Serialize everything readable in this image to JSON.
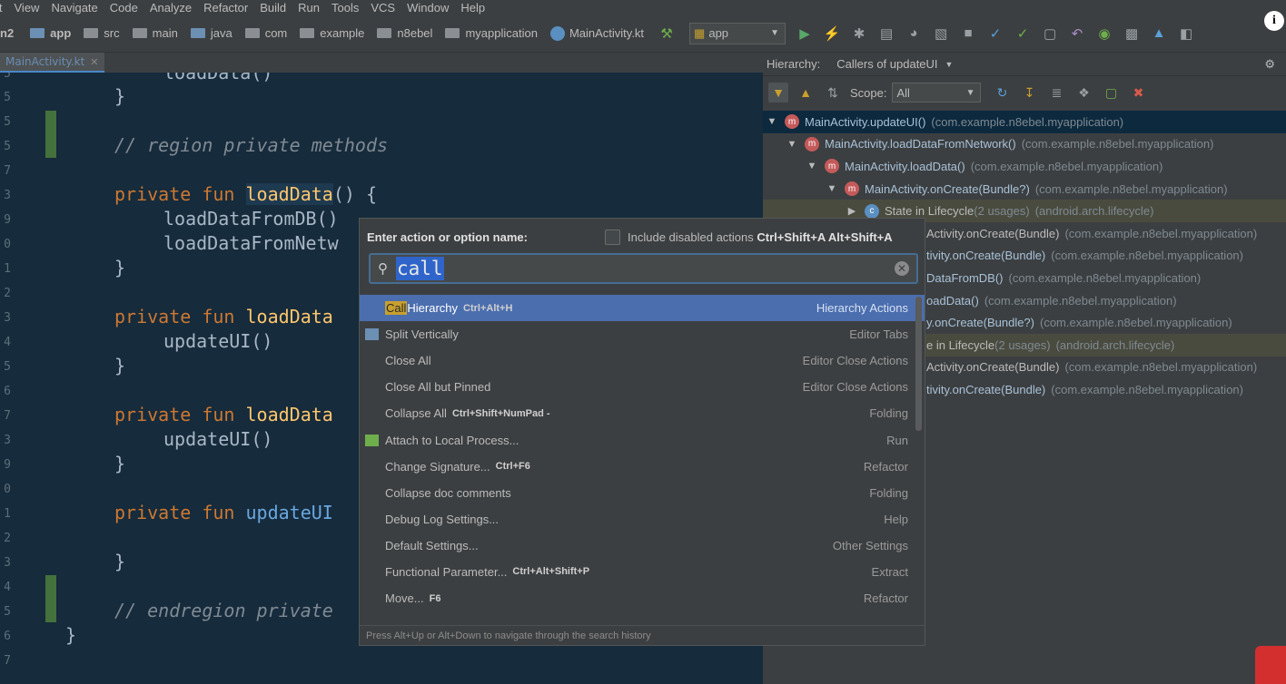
{
  "menu": [
    "it",
    "View",
    "Navigate",
    "Code",
    "Analyze",
    "Refactor",
    "Build",
    "Run",
    "Tools",
    "VCS",
    "Window",
    "Help"
  ],
  "nav": {
    "left_label": "n2",
    "crumbs": [
      "app",
      "src",
      "main",
      "java",
      "com",
      "example",
      "n8ebel",
      "myapplication",
      "MainActivity.kt"
    ],
    "run_config": "app"
  },
  "editor": {
    "tab": "MainActivity.kt",
    "gutter": [
      "5",
      "5",
      "5",
      "5",
      "7",
      "3",
      "9",
      "0",
      "1",
      "2",
      "3",
      "4",
      "5",
      "6",
      "7",
      "3",
      "9",
      "0",
      "1",
      "2",
      "3",
      "4",
      "5",
      "6",
      "7"
    ],
    "lines": {
      "l0": "loadData()",
      "l1": "}",
      "l2": "// region private methods",
      "l3_kw": "private fun",
      "l3_fn": "loadData",
      "l3_tail": "() {",
      "l4": "loadDataFromDB()",
      "l5": "loadDataFromNetw",
      "l6": "}",
      "l7_kw": "private fun",
      "l7_fn": "loadData",
      "l8": "updateUI()",
      "l9": "}",
      "l10_kw": "private fun",
      "l10_fn": "loadData",
      "l11": "updateUI()",
      "l12": "}",
      "l13_kw": "private fun",
      "l13_fn": "updateUI",
      "l14": "}",
      "l15": "// endregion private",
      "l16": "}"
    }
  },
  "hierarchy": {
    "label": "Hierarchy:",
    "type": "Callers of updateUI",
    "scope_label": "Scope:",
    "scope_value": "All",
    "rows": [
      {
        "name": "MainActivity.updateUI()",
        "pkg": "(com.example.n8ebel.myapplication)"
      },
      {
        "name": "MainActivity.loadDataFromNetwork()",
        "pkg": "(com.example.n8ebel.myapplication)"
      },
      {
        "name": "MainActivity.loadData()",
        "pkg": "(com.example.n8ebel.myapplication)"
      },
      {
        "name": "MainActivity.onCreate(Bundle?)",
        "pkg": "(com.example.n8ebel.myapplication)"
      },
      {
        "name": "State in Lifecycle",
        "count": "(2 usages)",
        "pkg": "(android.arch.lifecycle)"
      },
      {
        "name": "Activity.onCreate(Bundle)",
        "pkg": "(com.example.n8ebel.myapplication)"
      },
      {
        "name": "tivity.onCreate(Bundle)",
        "pkg": "(com.example.n8ebel.myapplication)"
      },
      {
        "name": "DataFromDB()",
        "pkg": "(com.example.n8ebel.myapplication)"
      },
      {
        "name": "oadData()",
        "pkg": "(com.example.n8ebel.myapplication)"
      },
      {
        "name": "y.onCreate(Bundle?)",
        "pkg": "(com.example.n8ebel.myapplication)"
      },
      {
        "name": "e in Lifecycle",
        "count": "(2 usages)",
        "pkg": "(android.arch.lifecycle)"
      },
      {
        "name": "Activity.onCreate(Bundle)",
        "pkg": "(com.example.n8ebel.myapplication)"
      },
      {
        "name": "tivity.onCreate(Bundle)",
        "pkg": "(com.example.n8ebel.myapplication)"
      }
    ]
  },
  "popup": {
    "title": "Enter action or option name:",
    "include_label": "Include disabled actions",
    "include_shortcut": "Ctrl+Shift+A Alt+Shift+A",
    "query": "call",
    "results": [
      {
        "label_hl": "Call",
        "label": " Hierarchy",
        "shortcut": "Ctrl+Alt+H",
        "group": "Hierarchy Actions"
      },
      {
        "label": "Split Vertically",
        "shortcut": "",
        "group": "Editor Tabs"
      },
      {
        "label": "Close All",
        "shortcut": "",
        "group": "Editor Close Actions"
      },
      {
        "label": "Close All but Pinned",
        "shortcut": "",
        "group": "Editor Close Actions"
      },
      {
        "label": "Collapse All",
        "shortcut": "Ctrl+Shift+NumPad -",
        "group": "Folding"
      },
      {
        "label": "Attach to Local Process...",
        "shortcut": "",
        "group": "Run"
      },
      {
        "label": "Change Signature...",
        "shortcut": "Ctrl+F6",
        "group": "Refactor"
      },
      {
        "label": "Collapse doc comments",
        "shortcut": "",
        "group": "Folding"
      },
      {
        "label": "Debug Log Settings...",
        "shortcut": "",
        "group": "Help"
      },
      {
        "label": "Default Settings...",
        "shortcut": "",
        "group": "Other Settings"
      },
      {
        "label": "Functional Parameter...",
        "shortcut": "Ctrl+Alt+Shift+P",
        "group": "Extract"
      },
      {
        "label": "Move...",
        "shortcut": "F6",
        "group": "Refactor"
      }
    ],
    "footer": "Press Alt+Up or Alt+Down to navigate through the search history"
  }
}
